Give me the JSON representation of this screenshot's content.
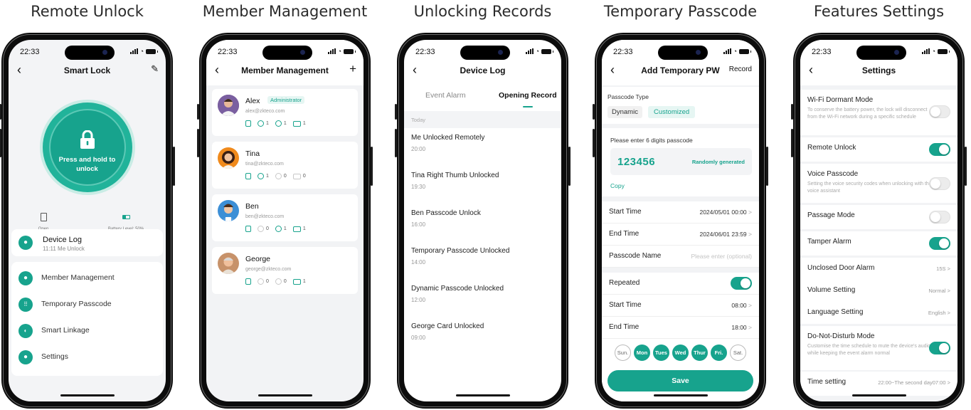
{
  "headings": [
    "Remote Unlock",
    "Member Management",
    "Unlocking Records",
    "Temporary Passcode",
    "Features Settings"
  ],
  "status_time": "22:33",
  "back_icon": "‹",
  "chevron": ">",
  "screen1": {
    "title": "Smart Lock",
    "edit_icon": "✎",
    "press_hold": "Press and hold to unlock",
    "open_label": "Open",
    "battery_label": "Battery Level: 50%",
    "device_log_title": "Device Log",
    "device_log_sub": "11:11 Me Unlock",
    "menu": [
      "Member Management",
      "Temporary Passcode",
      "Smart Linkage",
      "Settings"
    ]
  },
  "screen2": {
    "title": "Member Management",
    "add_icon": "+",
    "members": [
      {
        "name": "Alex",
        "badge": "Administrator",
        "email": "alex@zkteco.com",
        "counts": [
          "1",
          "1",
          "1"
        ]
      },
      {
        "name": "Tina",
        "badge": "",
        "email": "tina@zkteco.com",
        "counts": [
          "1",
          "0",
          "0"
        ]
      },
      {
        "name": "Ben",
        "badge": "",
        "email": "ben@zkteco.com",
        "counts": [
          "0",
          "1",
          "1"
        ]
      },
      {
        "name": "George",
        "badge": "",
        "email": "george@zkteco.com",
        "counts": [
          "0",
          "0",
          "1"
        ]
      }
    ]
  },
  "screen3": {
    "title": "Device Log",
    "tab_event": "Event Alarm",
    "tab_opening": "Opening Record",
    "section": "Today",
    "records": [
      {
        "title": "Me Unlocked Remotely",
        "time": "20:00"
      },
      {
        "title": "Tina Right Thumb Unlocked",
        "time": "19:30"
      },
      {
        "title": "Ben Passcode Unlock",
        "time": "16:00"
      },
      {
        "title": "Temporary Passcode Unlocked",
        "time": "14:00"
      },
      {
        "title": "Dynamic Passcode Unlocked",
        "time": "12:00"
      },
      {
        "title": "George Card Unlocked",
        "time": "09:00"
      }
    ]
  },
  "screen4": {
    "title": "Add Temporary PW",
    "record": "Record",
    "passcode_type_label": "Passcode Type",
    "type_dynamic": "Dynamic",
    "type_customized": "Customized",
    "enter_label": "Please enter 6 digits passcode",
    "passcode": "123456",
    "random": "Randomly generated",
    "copy": "Copy",
    "start_time_label": "Start Time",
    "start_time": "2024/05/01 00:00",
    "end_time_label": "End Time",
    "end_time": "2024/06/01 23:59",
    "name_label": "Passcode Name",
    "name_placeholder": "Please enter (optional)",
    "repeated_label": "Repeated",
    "repeated_on": true,
    "daily_start_label": "Start Time",
    "daily_start": "08:00",
    "daily_end_label": "End Time",
    "daily_end": "18:00",
    "days": [
      {
        "label": "Sun.",
        "on": false
      },
      {
        "label": "Mon",
        "on": true
      },
      {
        "label": "Tues",
        "on": true
      },
      {
        "label": "Wed",
        "on": true
      },
      {
        "label": "Thur",
        "on": true
      },
      {
        "label": "Fri.",
        "on": true
      },
      {
        "label": "Sat.",
        "on": false
      }
    ],
    "save": "Save"
  },
  "screen5": {
    "title": "Settings",
    "items": [
      {
        "label": "Wi-Fi Dormant Mode",
        "desc": "To conserve the battery power, the lock will disconnect from the Wi-Fi network during a specific schedule",
        "toggle": false
      },
      {
        "label": "Remote Unlock",
        "desc": "",
        "toggle": true
      },
      {
        "label": "Voice Passcode",
        "desc": "Setting the voice security codes when unlocking with the voice assistant",
        "toggle": false
      },
      {
        "label": "Passage Mode",
        "desc": "",
        "toggle": false
      },
      {
        "label": "Tamper Alarm",
        "desc": "",
        "toggle": true
      },
      {
        "label": "Unclosed Door Alarm",
        "value": "15S"
      },
      {
        "label": "Volume Setting",
        "value": "Normal"
      },
      {
        "label": "Language Setting",
        "value": "English"
      },
      {
        "label": "Do-Not-Disturb Mode",
        "desc": "Customise the time schedule to mute the device's audio, while keeping the event alarm normal",
        "toggle": true
      },
      {
        "label": "Time setting",
        "value": "22:00~The second day07:00"
      }
    ]
  },
  "colors": {
    "accent": "#17a38d",
    "accent_light": "#e6f6f3",
    "bg": "#f3f4f6"
  }
}
